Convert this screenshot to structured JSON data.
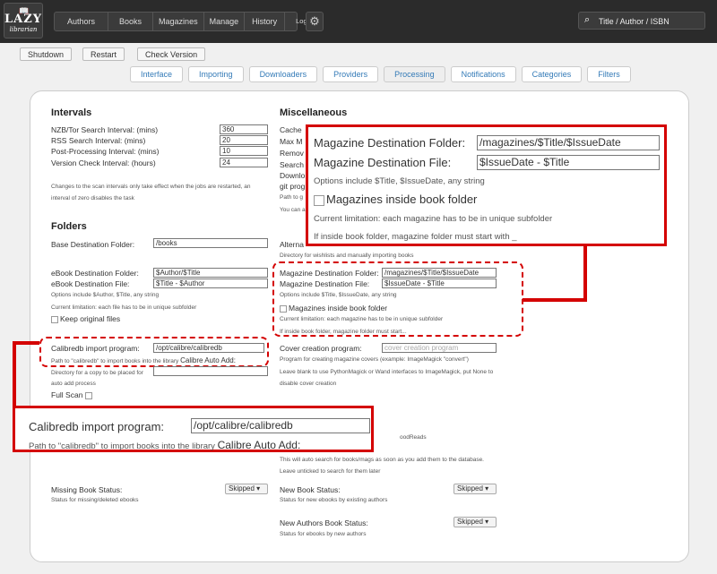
{
  "logo": {
    "line1": "LAZY",
    "line2": "librarian"
  },
  "nav": {
    "items": [
      "Authors",
      "Books",
      "Magazines",
      "Manage",
      "History",
      "Logs"
    ]
  },
  "search": {
    "placeholder": "Title / Author / ISBN"
  },
  "actions": {
    "shutdown": "Shutdown",
    "restart": "Restart",
    "check_version": "Check Version"
  },
  "tabs": [
    "Interface",
    "Importing",
    "Downloaders",
    "Providers",
    "Processing",
    "Notifications",
    "Categories",
    "Filters"
  ],
  "intervals": {
    "title": "Intervals",
    "nzb_label": "NZB/Tor Search Interval: (mins)",
    "nzb_value": "360",
    "rss_label": "RSS Search Interval: (mins)",
    "rss_value": "20",
    "post_label": "Post-Processing Interval: (mins)",
    "post_value": "10",
    "version_label": "Version Check Interval: (hours)",
    "version_value": "24",
    "note1": "Changes to the scan intervals only take effect when the jobs are restarted, an",
    "note2": "interval of zero disables the task"
  },
  "misc": {
    "title": "Miscellaneous",
    "l1": "Cache",
    "l2": "Max M",
    "l3": "Remov",
    "l4": "Search",
    "l5": "Downlo",
    "l6": "git prog",
    "l7": "Path to g",
    "l8": "You can a"
  },
  "folders": {
    "title": "Folders",
    "base_label": "Base Destination Folder:",
    "base_value": "/books",
    "ebook_folder_label": "eBook Destination Folder:",
    "ebook_folder_value": "$Author/$Title",
    "ebook_file_label": "eBook Destination File:",
    "ebook_file_value": "$Title - $Author",
    "ebook_options": "Options include $Author, $Title, any string",
    "ebook_limit": "Current limitation: each file has to be in unique subfolder",
    "keep_original": "Keep original files",
    "calibredb_label": "Calibredb import program:",
    "calibredb_value": "/opt/calibre/calibredb",
    "calibredb_note": "Path to \"calibredb\" to import books into the library",
    "calibre_auto_add": "Calibre Auto Add:",
    "copy_note1": "Directory for a copy to be placed for",
    "copy_note2": "auto add process",
    "full_scan": "Full Scan"
  },
  "alternate": {
    "label": "Alterna",
    "note": "Directory for wishlists and manually importing books"
  },
  "magazine": {
    "folder_label": "Magazine Destination Folder:",
    "folder_value": "/magazines/$Title/$IssueDate",
    "file_label": "Magazine Destination File:",
    "file_value": "$IssueDate - $Title",
    "options": "Options include $Title, $IssueDate, any string",
    "inside_book": "Magazines inside book folder",
    "limitation": "Current limitation: each magazine has to be in unique subfolder",
    "must_start": "If inside book folder, magazine folder must start with _",
    "must_start_small": "If inside book folder, magazine folder must start..."
  },
  "cover": {
    "label": "Cover creation program:",
    "placeholder": "cover creation program",
    "note1": "Program for creating magazine covers (example: ImageMagick \"convert\")",
    "note2": "Leave blank to use PythonMagick or Wand interfaces to ImageMagick, put None to",
    "note3": "disable cover creation"
  },
  "goodreads": {
    "tail": "oodReads",
    "note1": "This will auto search for books/mags as soon as you add them to the database.",
    "note2": "Leave unticked to search for them later"
  },
  "status": {
    "missing_label": "Missing Book Status:",
    "missing_value": "Skipped",
    "missing_note": "Status for missing/deleted ebooks",
    "new_book_label": "New Book Status:",
    "new_book_value": "Skipped",
    "new_book_note": "Status for new ebooks by existing authors",
    "new_authors_label": "New Authors Book Status:",
    "new_authors_value": "Skipped",
    "new_authors_note": "Status for ebooks by new authors"
  },
  "colors": {
    "highlight": "#d40000",
    "nav_bg": "#2b2b2b",
    "link": "#337ab7"
  }
}
